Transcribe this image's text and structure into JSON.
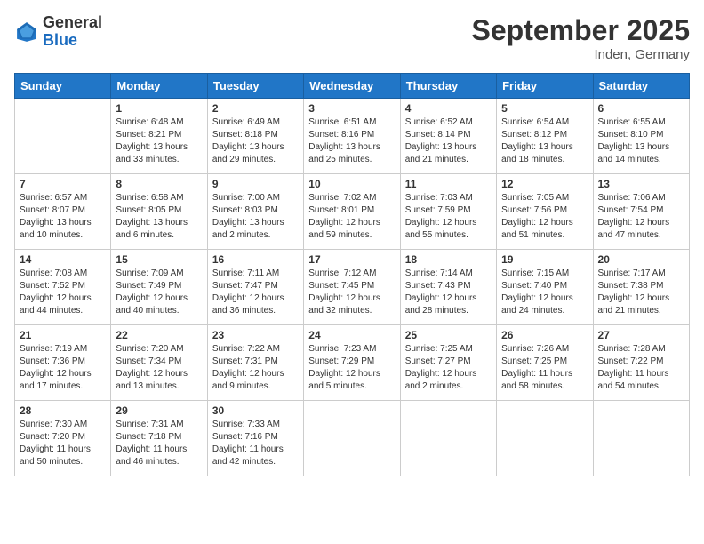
{
  "logo": {
    "line1": "General",
    "line2": "Blue"
  },
  "title": "September 2025",
  "subtitle": "Inden, Germany",
  "days_of_week": [
    "Sunday",
    "Monday",
    "Tuesday",
    "Wednesday",
    "Thursday",
    "Friday",
    "Saturday"
  ],
  "weeks": [
    [
      {
        "day": "",
        "sunrise": "",
        "sunset": "",
        "daylight": ""
      },
      {
        "day": "1",
        "sunrise": "Sunrise: 6:48 AM",
        "sunset": "Sunset: 8:21 PM",
        "daylight": "Daylight: 13 hours and 33 minutes."
      },
      {
        "day": "2",
        "sunrise": "Sunrise: 6:49 AM",
        "sunset": "Sunset: 8:18 PM",
        "daylight": "Daylight: 13 hours and 29 minutes."
      },
      {
        "day": "3",
        "sunrise": "Sunrise: 6:51 AM",
        "sunset": "Sunset: 8:16 PM",
        "daylight": "Daylight: 13 hours and 25 minutes."
      },
      {
        "day": "4",
        "sunrise": "Sunrise: 6:52 AM",
        "sunset": "Sunset: 8:14 PM",
        "daylight": "Daylight: 13 hours and 21 minutes."
      },
      {
        "day": "5",
        "sunrise": "Sunrise: 6:54 AM",
        "sunset": "Sunset: 8:12 PM",
        "daylight": "Daylight: 13 hours and 18 minutes."
      },
      {
        "day": "6",
        "sunrise": "Sunrise: 6:55 AM",
        "sunset": "Sunset: 8:10 PM",
        "daylight": "Daylight: 13 hours and 14 minutes."
      }
    ],
    [
      {
        "day": "7",
        "sunrise": "Sunrise: 6:57 AM",
        "sunset": "Sunset: 8:07 PM",
        "daylight": "Daylight: 13 hours and 10 minutes."
      },
      {
        "day": "8",
        "sunrise": "Sunrise: 6:58 AM",
        "sunset": "Sunset: 8:05 PM",
        "daylight": "Daylight: 13 hours and 6 minutes."
      },
      {
        "day": "9",
        "sunrise": "Sunrise: 7:00 AM",
        "sunset": "Sunset: 8:03 PM",
        "daylight": "Daylight: 13 hours and 2 minutes."
      },
      {
        "day": "10",
        "sunrise": "Sunrise: 7:02 AM",
        "sunset": "Sunset: 8:01 PM",
        "daylight": "Daylight: 12 hours and 59 minutes."
      },
      {
        "day": "11",
        "sunrise": "Sunrise: 7:03 AM",
        "sunset": "Sunset: 7:59 PM",
        "daylight": "Daylight: 12 hours and 55 minutes."
      },
      {
        "day": "12",
        "sunrise": "Sunrise: 7:05 AM",
        "sunset": "Sunset: 7:56 PM",
        "daylight": "Daylight: 12 hours and 51 minutes."
      },
      {
        "day": "13",
        "sunrise": "Sunrise: 7:06 AM",
        "sunset": "Sunset: 7:54 PM",
        "daylight": "Daylight: 12 hours and 47 minutes."
      }
    ],
    [
      {
        "day": "14",
        "sunrise": "Sunrise: 7:08 AM",
        "sunset": "Sunset: 7:52 PM",
        "daylight": "Daylight: 12 hours and 44 minutes."
      },
      {
        "day": "15",
        "sunrise": "Sunrise: 7:09 AM",
        "sunset": "Sunset: 7:49 PM",
        "daylight": "Daylight: 12 hours and 40 minutes."
      },
      {
        "day": "16",
        "sunrise": "Sunrise: 7:11 AM",
        "sunset": "Sunset: 7:47 PM",
        "daylight": "Daylight: 12 hours and 36 minutes."
      },
      {
        "day": "17",
        "sunrise": "Sunrise: 7:12 AM",
        "sunset": "Sunset: 7:45 PM",
        "daylight": "Daylight: 12 hours and 32 minutes."
      },
      {
        "day": "18",
        "sunrise": "Sunrise: 7:14 AM",
        "sunset": "Sunset: 7:43 PM",
        "daylight": "Daylight: 12 hours and 28 minutes."
      },
      {
        "day": "19",
        "sunrise": "Sunrise: 7:15 AM",
        "sunset": "Sunset: 7:40 PM",
        "daylight": "Daylight: 12 hours and 24 minutes."
      },
      {
        "day": "20",
        "sunrise": "Sunrise: 7:17 AM",
        "sunset": "Sunset: 7:38 PM",
        "daylight": "Daylight: 12 hours and 21 minutes."
      }
    ],
    [
      {
        "day": "21",
        "sunrise": "Sunrise: 7:19 AM",
        "sunset": "Sunset: 7:36 PM",
        "daylight": "Daylight: 12 hours and 17 minutes."
      },
      {
        "day": "22",
        "sunrise": "Sunrise: 7:20 AM",
        "sunset": "Sunset: 7:34 PM",
        "daylight": "Daylight: 12 hours and 13 minutes."
      },
      {
        "day": "23",
        "sunrise": "Sunrise: 7:22 AM",
        "sunset": "Sunset: 7:31 PM",
        "daylight": "Daylight: 12 hours and 9 minutes."
      },
      {
        "day": "24",
        "sunrise": "Sunrise: 7:23 AM",
        "sunset": "Sunset: 7:29 PM",
        "daylight": "Daylight: 12 hours and 5 minutes."
      },
      {
        "day": "25",
        "sunrise": "Sunrise: 7:25 AM",
        "sunset": "Sunset: 7:27 PM",
        "daylight": "Daylight: 12 hours and 2 minutes."
      },
      {
        "day": "26",
        "sunrise": "Sunrise: 7:26 AM",
        "sunset": "Sunset: 7:25 PM",
        "daylight": "Daylight: 11 hours and 58 minutes."
      },
      {
        "day": "27",
        "sunrise": "Sunrise: 7:28 AM",
        "sunset": "Sunset: 7:22 PM",
        "daylight": "Daylight: 11 hours and 54 minutes."
      }
    ],
    [
      {
        "day": "28",
        "sunrise": "Sunrise: 7:30 AM",
        "sunset": "Sunset: 7:20 PM",
        "daylight": "Daylight: 11 hours and 50 minutes."
      },
      {
        "day": "29",
        "sunrise": "Sunrise: 7:31 AM",
        "sunset": "Sunset: 7:18 PM",
        "daylight": "Daylight: 11 hours and 46 minutes."
      },
      {
        "day": "30",
        "sunrise": "Sunrise: 7:33 AM",
        "sunset": "Sunset: 7:16 PM",
        "daylight": "Daylight: 11 hours and 42 minutes."
      },
      {
        "day": "",
        "sunrise": "",
        "sunset": "",
        "daylight": ""
      },
      {
        "day": "",
        "sunrise": "",
        "sunset": "",
        "daylight": ""
      },
      {
        "day": "",
        "sunrise": "",
        "sunset": "",
        "daylight": ""
      },
      {
        "day": "",
        "sunrise": "",
        "sunset": "",
        "daylight": ""
      }
    ]
  ]
}
